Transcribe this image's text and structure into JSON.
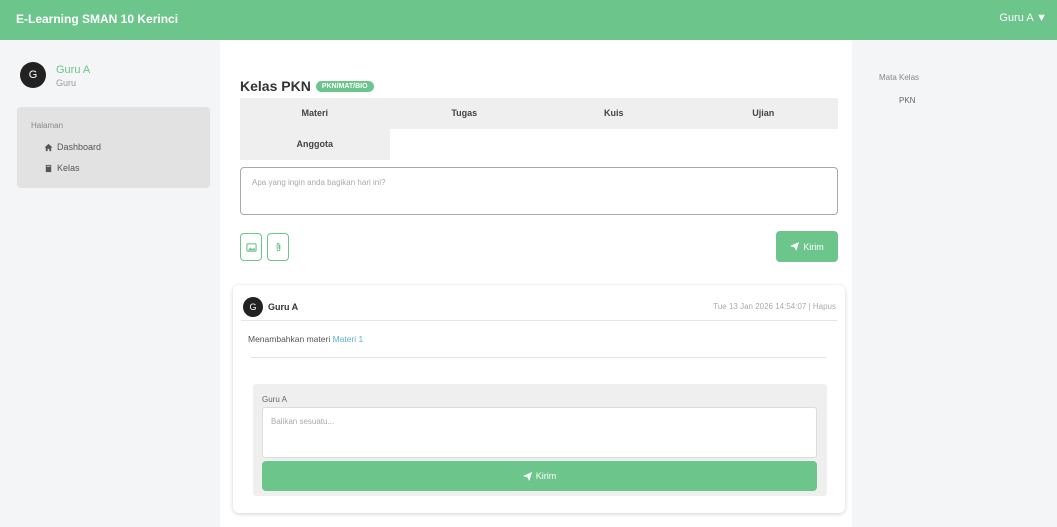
{
  "app": {
    "title": "E-Learning SMAN 10 Kerinci",
    "user_menu": "Guru A ▼"
  },
  "profile": {
    "avatar_initial": "G",
    "name": "Guru A",
    "role": "Guru"
  },
  "sidebar": {
    "heading": "Halaman",
    "items": [
      {
        "label": "Dashboard",
        "icon": "home-icon"
      },
      {
        "label": "Kelas",
        "icon": "book-icon"
      }
    ]
  },
  "class": {
    "title": "Kelas PKN",
    "badge": "PKN/MAT/BIO",
    "tabs": [
      "Materi",
      "Tugas",
      "Kuis",
      "Ujian",
      "Anggota"
    ]
  },
  "composer": {
    "placeholder": "Apa yang ingin anda bagikan hari ini?",
    "send_label": "Kirim"
  },
  "post": {
    "avatar_initial": "G",
    "author": "Guru A",
    "time": "Tue 13 Jan 2026 14:54:07 | Hapus",
    "body_text": "Menambahkan materi ",
    "body_link": "Materi 1",
    "comment_user": "Guru A",
    "comment_placeholder": "Balikan sesuatu...",
    "comment_send_label": "Kirim"
  },
  "right_panel": {
    "heading": "Mata Kelas",
    "item": "PKN"
  },
  "colors": {
    "accent": "#6cc58a",
    "link": "#5fb0d0"
  }
}
